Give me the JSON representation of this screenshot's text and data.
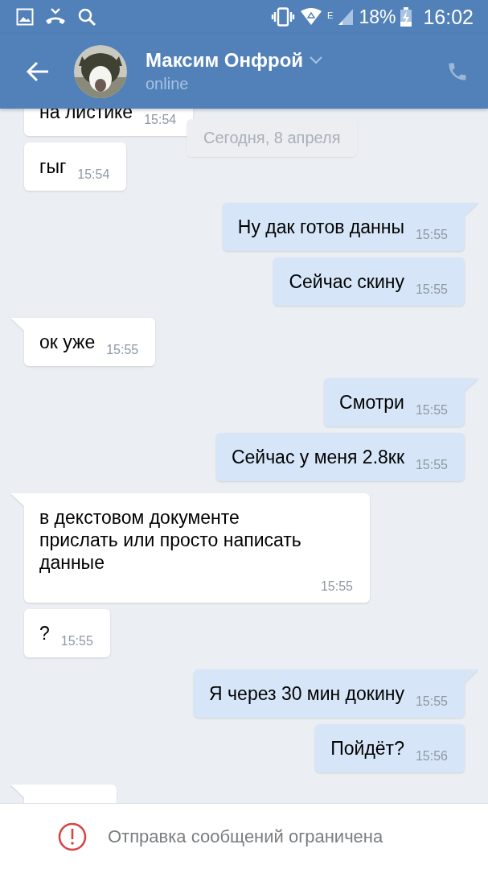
{
  "status_bar": {
    "network": "E",
    "battery": "18%",
    "time": "16:02"
  },
  "header": {
    "name": "Максим Онфрой",
    "status": "online"
  },
  "date_badge": "Сегодня, 8 апреля",
  "messages": [
    {
      "kind": "incoming",
      "tail": false,
      "text": "на листике",
      "time": "15:54"
    },
    {
      "kind": "incoming",
      "tail": false,
      "text": "гыг",
      "time": "15:54"
    },
    {
      "kind": "outgoing",
      "tail": true,
      "text": "Ну дак готов данны",
      "time": "15:55"
    },
    {
      "kind": "outgoing",
      "tail": false,
      "text": "Сейчас скину",
      "time": "15:55"
    },
    {
      "kind": "incoming",
      "tail": true,
      "text": "ок уже",
      "time": "15:55"
    },
    {
      "kind": "outgoing",
      "tail": true,
      "text": "Смотри",
      "time": "15:55"
    },
    {
      "kind": "outgoing",
      "tail": false,
      "text": "Сейчас у меня 2.8кк",
      "time": "15:55"
    },
    {
      "kind": "incoming",
      "tail": true,
      "text": "в декстовом документе прислать или просто написать данные",
      "time": "15:55"
    },
    {
      "kind": "incoming",
      "tail": false,
      "text": "?",
      "time": "15:55"
    },
    {
      "kind": "outgoing",
      "tail": true,
      "text": "Я через 30 мин докину",
      "time": "15:55"
    },
    {
      "kind": "outgoing",
      "tail": false,
      "text": "Пойдёт?",
      "time": "15:56"
    },
    {
      "kind": "incoming",
      "tail": true
    }
  ],
  "notice": "Отправка сообщений ограничена"
}
